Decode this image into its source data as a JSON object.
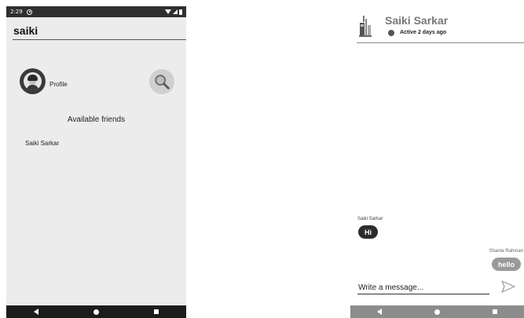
{
  "status_bar": {
    "time": "2:29"
  },
  "search": {
    "value": "saiki"
  },
  "profile": {
    "label": "Profile"
  },
  "friends": {
    "title": "Available friends",
    "items": [
      {
        "name": "Saiki Sarkar"
      }
    ]
  },
  "chat": {
    "header": {
      "name": "Saiki Sarkar",
      "presence": "Active 2 days ago"
    },
    "messages": [
      {
        "sender": "Saiki Sarkar",
        "text": "Hi",
        "direction": "incoming"
      },
      {
        "sender": "Shanta Rahman",
        "text": "hello",
        "direction": "outgoing"
      }
    ],
    "input": {
      "placeholder": "Write a message..."
    }
  },
  "icons": {
    "search": "search-icon",
    "send": "send-icon",
    "avatar": "avatar-icon",
    "nav_back": "back-icon",
    "nav_home": "home-icon",
    "nav_recent": "recent-apps-icon"
  },
  "colors": {
    "incoming_bubble": "#2c2c2c",
    "outgoing_bubble": "#9a9a9a",
    "left_background": "#ececec"
  }
}
